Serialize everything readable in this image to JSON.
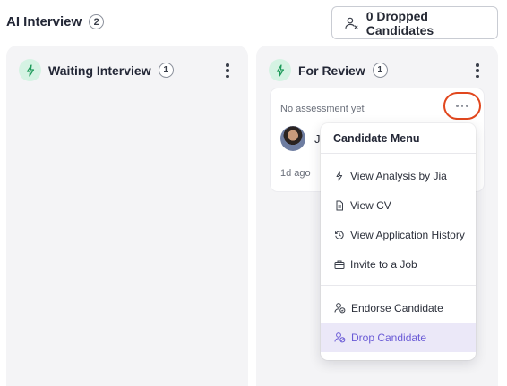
{
  "header": {
    "title": "AI Interview",
    "count": "2"
  },
  "dropped_button": {
    "label": "0 Dropped Candidates"
  },
  "columns": [
    {
      "title": "Waiting Interview",
      "count": "1"
    },
    {
      "title": "For Review",
      "count": "1"
    }
  ],
  "card": {
    "status": "No assessment yet",
    "name_initial": "J",
    "time": "1d ago"
  },
  "menu": {
    "title": "Candidate Menu",
    "items": [
      {
        "label": "View Analysis by Jia",
        "icon": "bolt-icon"
      },
      {
        "label": "View CV",
        "icon": "document-icon"
      },
      {
        "label": "View Application History",
        "icon": "history-icon"
      },
      {
        "label": "Invite to a Job",
        "icon": "briefcase-icon"
      },
      {
        "label": "Endorse Candidate",
        "icon": "user-check-icon"
      },
      {
        "label": "Drop Candidate",
        "icon": "user-drop-icon"
      }
    ],
    "active_color": "#6a5bd6"
  },
  "colors": {
    "accent_green_bg": "#d5f3e3",
    "bolt_green": "#1e9a5a",
    "highlight_ring": "#e1471e"
  }
}
